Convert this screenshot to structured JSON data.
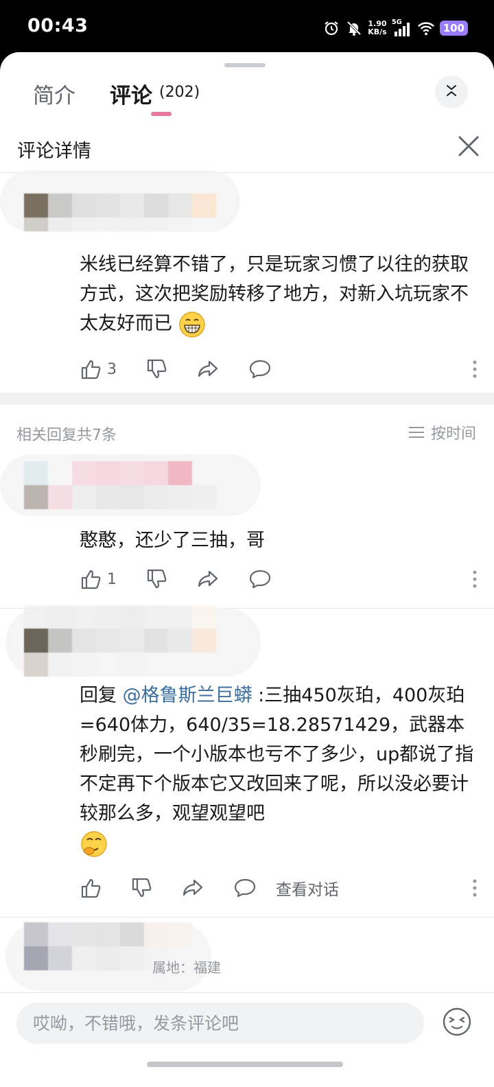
{
  "status_bar": {
    "time": "00:43",
    "net_speed_value": "1.90",
    "net_speed_unit": "KB/s",
    "network_type": "5G",
    "battery": "100"
  },
  "tabs": {
    "intro_label": "简介",
    "comments_label": "评论",
    "comments_count": "(202)"
  },
  "detail": {
    "title": "评论详情"
  },
  "main_comment": {
    "text": "米线已经算不错了，只是玩家习惯了以往的获取方式，这次把奖励转移了地方，对新入坑玩家不太友好而已",
    "emoji": "grin-emoji",
    "like_count": "3"
  },
  "replies": {
    "count_label": "相关回复共7条",
    "sort_label": "按时间",
    "items": [
      {
        "text": "憨憨，还少了三抽，哥",
        "like_count": "1"
      },
      {
        "reply_prefix": "回复 ",
        "mention": "@格鲁斯兰巨蟒",
        "text": " :三抽450灰珀，400灰珀=640体力，640/35=18.28571429，武器本秒刷完，一个小版本也亏不了多少，up都说了指不定再下个版本它又改回来了呢，所以没必要计较那么多，观望观望吧",
        "emoji": "smirk-emoji",
        "view_conversation": "查看对话"
      }
    ],
    "partial_location": "属地：福建"
  },
  "input": {
    "placeholder": "哎呦，不错哦，发条评论吧"
  },
  "colors": {
    "accent_pink": "#e8779e",
    "mention_blue": "#3c6f9e",
    "text_primary": "#18191c",
    "text_secondary": "#61666d",
    "text_muted": "#9499a0"
  }
}
